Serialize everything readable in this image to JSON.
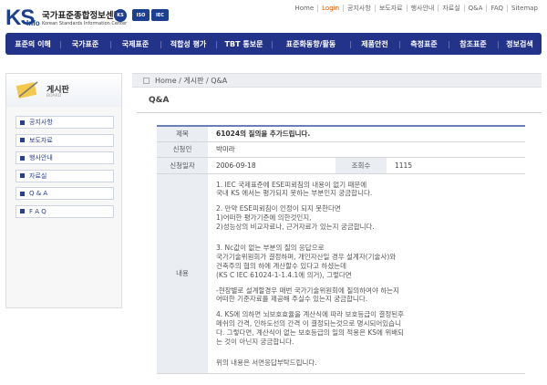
{
  "header": {
    "logo_ks": "KS",
    "logo_info": "Info",
    "logo_kor": "국가표준종합정보센터",
    "logo_eng": "Korean Standards Information Center",
    "cert_ks": "KS",
    "cert_iso": "ISO",
    "cert_iec": "IEC",
    "top_links": [
      "Home",
      "Login",
      "공지사항",
      "보도자료",
      "행사안내",
      "자료실",
      "Q&A",
      "FAQ",
      "Sitemap"
    ]
  },
  "gnb": [
    "표준의 이해",
    "국가표준",
    "국제표준",
    "적합성 평가",
    "TBT 통보문",
    "표준화동향/활동",
    "제품안전",
    "측정표준",
    "참조표준",
    "정보검색"
  ],
  "sidebar": {
    "title": "게시판",
    "subtitle": "BOARD",
    "items": [
      "공지사항",
      "보도자료",
      "행사안내",
      "자료실",
      "Q & A",
      "F A Q"
    ]
  },
  "breadcrumb": "Home / 게시판 / Q&A",
  "page_title": "Q&A",
  "post": {
    "subject_label": "제목",
    "subject": "61024의 질의을 추가드립니다.",
    "author_label": "신청인",
    "author": "박미라",
    "date_label": "신청일자",
    "date": "2006-09-18",
    "views_label": "조회수",
    "views": "1115",
    "content_label": "내용",
    "content": {
      "p1": [
        "1. IEC 국제표준에 ESE피뢰침의 내용이 없기 때문에",
        "국내 KS 에서는 평가되지 못하는 부분인지 궁금합니다."
      ],
      "p2": [
        "2. 만약 ESE피뢰침이 인정이 되지 못한다면",
        "1)어떠한 평가기준에 의한것인지,",
        "2)성능상의 비교자료나, 근거자료가 있는지 궁금합니다."
      ],
      "p3": [
        "3. Nc값이 없는 부분의 질의 응답으로",
        "국가기술위원회가 결정하며, 개인자산일 경우 설계자(기술사)와",
        "건축주의 협의 하에 계산할수 있다고 하셨는데",
        "(KS C IEC 61024-1-1.4.1에 의거), 그렇다면"
      ],
      "p4": [
        "-현장별로 설계할경우 매번 국가기술위원회에 질의하여야 하는지",
        "어떠한 기준자료를 제공해 주실수 있는지 궁금합니다."
      ],
      "p5": [
        "4. KS에 의하면 뇌보호효율을 계산식에 따라 보호등급이 결정된후",
        "메쉬의 간격, 인하도선의 간격 이 결정되는것으로 명시되어있습니",
        "다. 그렇다면, 계산식이 없는 보호등급의 일의 적용은 KS에 위배되",
        "는 것이 아닌지 궁금합니다."
      ],
      "p6": [
        "위의 내용은 서면응답부탁드립니다."
      ]
    }
  },
  "colors": {
    "nav_bg": "#24338a",
    "accent": "#2b3f8f",
    "login": "#e05a00"
  }
}
